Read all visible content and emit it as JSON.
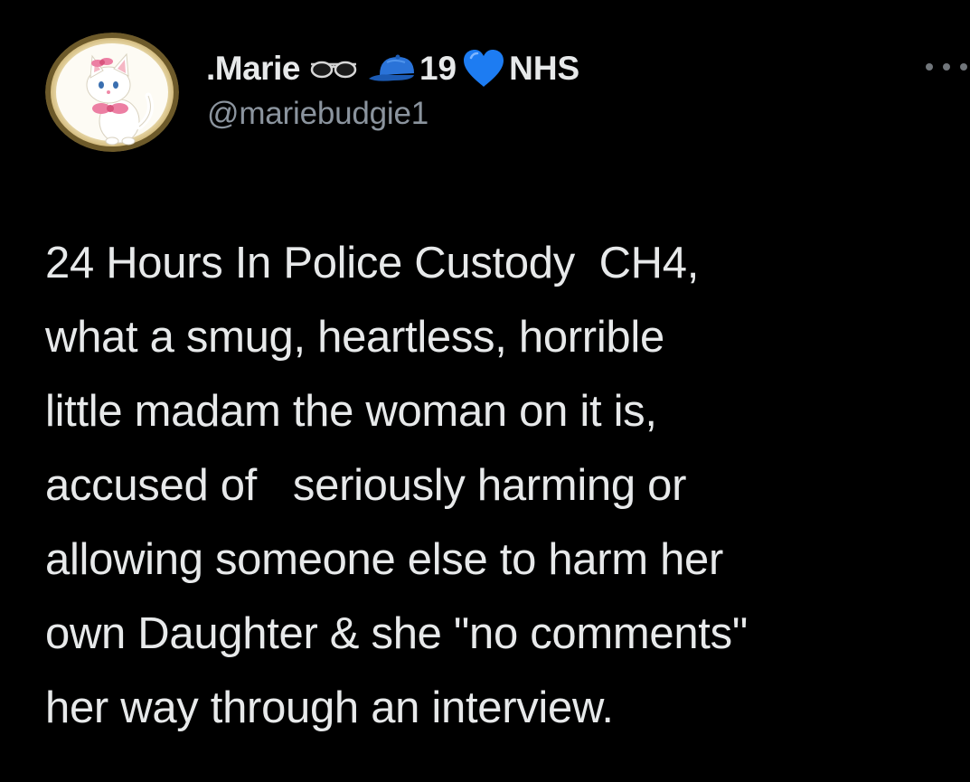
{
  "tweet": {
    "author": {
      "display_name": ".Marie",
      "name_emoji_1": "sunglasses-icon",
      "name_emoji_2": "blue-cap-icon",
      "name_number": "19",
      "name_emoji_3": "blue-heart-icon",
      "name_suffix": "NHS",
      "handle": "@mariebudgie1",
      "avatar": "white-cat-avatar"
    },
    "more_icon": "more-horizontal-icon",
    "body_lines": [
      "24 Hours In Police Custody  CH4,",
      "what a smug, heartless, horrible",
      "little madam the woman on it is,",
      "accused of   seriously harming or",
      "allowing someone else to harm her",
      "own Daughter & she \"no comments\"",
      "her way through an interview."
    ]
  },
  "colors": {
    "background": "#000000",
    "text": "#e7e9ea",
    "secondary": "#8b949e",
    "heart": "#1d9bf0"
  }
}
